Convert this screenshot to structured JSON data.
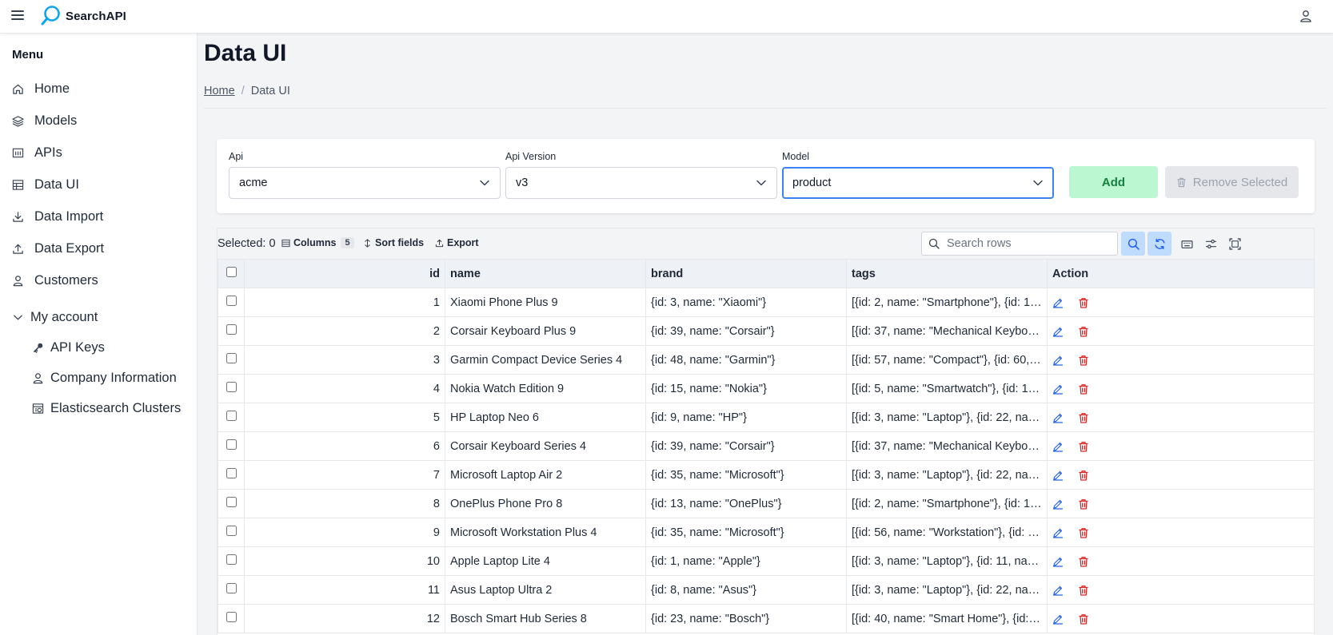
{
  "app": {
    "name": "SearchAPI"
  },
  "sidebar": {
    "title": "Menu",
    "items": [
      {
        "label": "Home",
        "icon": "home-icon"
      },
      {
        "label": "Models",
        "icon": "layers-icon"
      },
      {
        "label": "APIs",
        "icon": "api-icon"
      },
      {
        "label": "Data UI",
        "icon": "table-icon"
      },
      {
        "label": "Data Import",
        "icon": "download-icon"
      },
      {
        "label": "Data Export",
        "icon": "upload-icon"
      },
      {
        "label": "Customers",
        "icon": "user-icon"
      }
    ],
    "group": {
      "label": "My account",
      "items": [
        {
          "label": "API Keys",
          "icon": "key-icon"
        },
        {
          "label": "Company Information",
          "icon": "user-icon"
        },
        {
          "label": "Elasticsearch Clusters",
          "icon": "cluster-icon"
        }
      ]
    }
  },
  "page": {
    "title": "Data UI",
    "breadcrumb": {
      "home": "Home",
      "separator": "/",
      "current": "Data UI"
    }
  },
  "filters": {
    "api": {
      "label": "Api",
      "value": "acme"
    },
    "api_version": {
      "label": "Api Version",
      "value": "v3"
    },
    "model": {
      "label": "Model",
      "value": "product"
    },
    "add_label": "Add",
    "remove_label": "Remove Selected"
  },
  "toolbar": {
    "selected_text": "Selected: 0",
    "columns_label": "Columns",
    "columns_count": "5",
    "sort_label": "Sort fields",
    "export_label": "Export",
    "search_placeholder": "Search rows"
  },
  "table": {
    "columns": [
      "id",
      "name",
      "brand",
      "tags",
      "Action"
    ],
    "rows": [
      {
        "id": "1",
        "name": "Xiaomi Phone Plus 9",
        "brand": "{id: 3, name: \"Xiaomi\"}",
        "tags": "[{id: 2, name: \"Smartphone\"}, {id: 10..."
      },
      {
        "id": "2",
        "name": "Corsair Keyboard Plus 9",
        "brand": "{id: 39, name: \"Corsair\"}",
        "tags": "[{id: 37, name: \"Mechanical Keyboar..."
      },
      {
        "id": "3",
        "name": "Garmin Compact Device Series 4",
        "brand": "{id: 48, name: \"Garmin\"}",
        "tags": "[{id: 57, name: \"Compact\"}, {id: 60, ..."
      },
      {
        "id": "4",
        "name": "Nokia Watch Edition 9",
        "brand": "{id: 15, name: \"Nokia\"}",
        "tags": "[{id: 5, name: \"Smartwatch\"}, {id: 10..."
      },
      {
        "id": "5",
        "name": "HP Laptop Neo 6",
        "brand": "{id: 9, name: \"HP\"}",
        "tags": "[{id: 3, name: \"Laptop\"}, {id: 22, nam..."
      },
      {
        "id": "6",
        "name": "Corsair Keyboard Series 4",
        "brand": "{id: 39, name: \"Corsair\"}",
        "tags": "[{id: 37, name: \"Mechanical Keyboar..."
      },
      {
        "id": "7",
        "name": "Microsoft Laptop Air 2",
        "brand": "{id: 35, name: \"Microsoft\"}",
        "tags": "[{id: 3, name: \"Laptop\"}, {id: 22, nam..."
      },
      {
        "id": "8",
        "name": "OnePlus Phone Pro 8",
        "brand": "{id: 13, name: \"OnePlus\"}",
        "tags": "[{id: 2, name: \"Smartphone\"}, {id: 10..."
      },
      {
        "id": "9",
        "name": "Microsoft Workstation Plus 4",
        "brand": "{id: 35, name: \"Microsoft\"}",
        "tags": "[{id: 56, name: \"Workstation\"}, {id: 3,..."
      },
      {
        "id": "10",
        "name": "Apple Laptop Lite 4",
        "brand": "{id: 1, name: \"Apple\"}",
        "tags": "[{id: 3, name: \"Laptop\"}, {id: 11, nam..."
      },
      {
        "id": "11",
        "name": "Asus Laptop Ultra 2",
        "brand": "{id: 8, name: \"Asus\"}",
        "tags": "[{id: 3, name: \"Laptop\"}, {id: 22, nam..."
      },
      {
        "id": "12",
        "name": "Bosch Smart Hub Series 8",
        "brand": "{id: 23, name: \"Bosch\"}",
        "tags": "[{id: 40, name: \"Smart Home\"}, {id: 8..."
      }
    ]
  },
  "colors": {
    "accent": "#3b82f6",
    "add_bg": "#bbf7d0",
    "add_text": "#15803d",
    "delete": "#dc2626",
    "edit": "#2563eb"
  }
}
